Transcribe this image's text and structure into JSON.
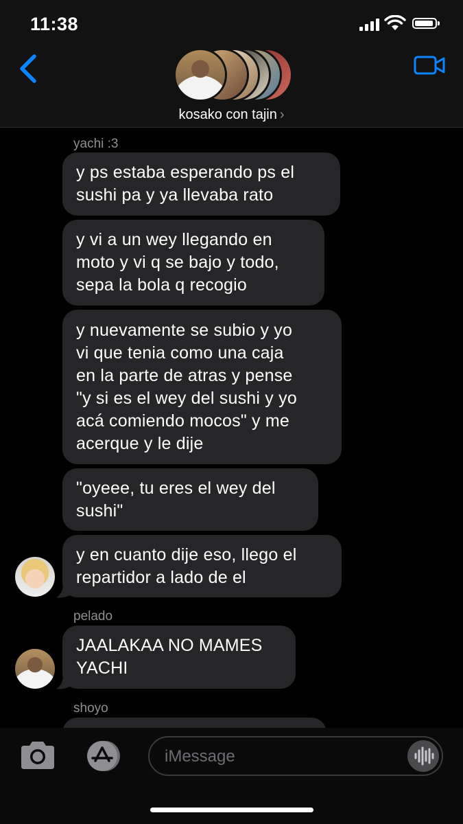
{
  "status": {
    "time": "11:38"
  },
  "header": {
    "group_name": "kosako con tajin",
    "chevron": "›"
  },
  "messages": [
    {
      "sender": "yachi :3",
      "text": "y ps estaba esperando ps el\nsushi pa y ya llevaba rato"
    },
    {
      "text": "y vi a un wey llegando en\nmoto y vi q se bajo y todo,\nsepa la bola q recogio"
    },
    {
      "text": "y nuevamente se subio y yo\nvi que tenia como una caja\nen la parte de atras y pense\n\"y si es el wey del sushi y yo\nacá comiendo mocos\" y me\nacerque y le dije"
    },
    {
      "text": "\"oyeee, tu eres el wey del\nsushi\""
    },
    {
      "text": "y en cuanto dije eso, llego el\nrepartidor a lado de el"
    },
    {
      "sender": "pelado",
      "text": "JAALAKAA NO MAMES\nYACHI"
    },
    {
      "sender": "shoyo"
    }
  ],
  "input": {
    "placeholder": "iMessage"
  },
  "colors": {
    "accent": "#0a84ff",
    "bubble": "#262628",
    "background": "#000000"
  }
}
